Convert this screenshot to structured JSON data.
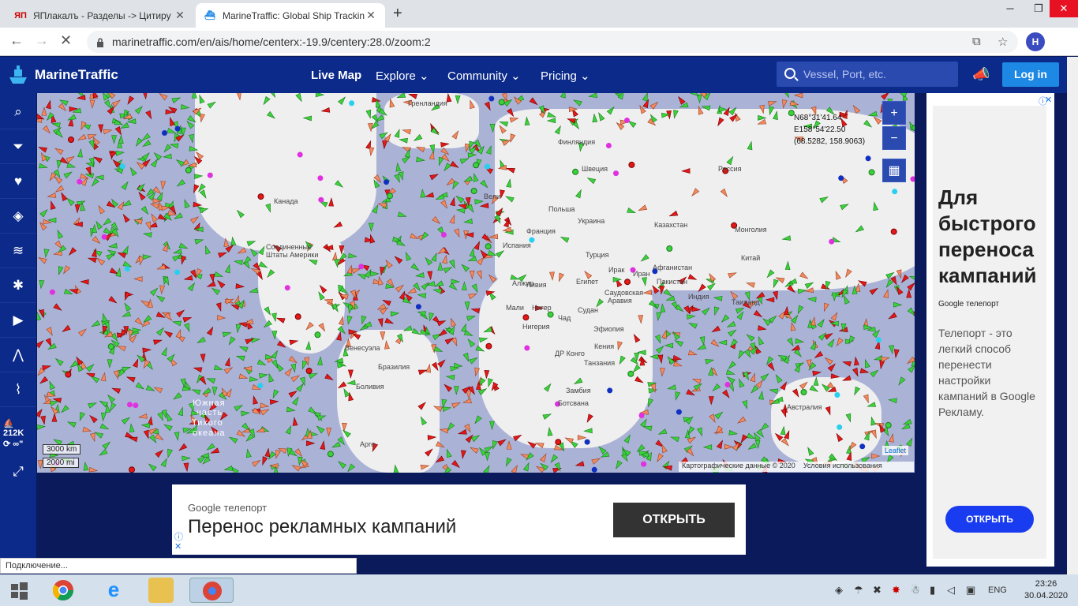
{
  "browser": {
    "tabs": [
      {
        "favicon": "yaplakal-favicon",
        "title": "ЯПлакалъ - Разделы -> Цитиру"
      },
      {
        "favicon": "marinetraffic-favicon",
        "title": "MarineTraffic: Global Ship Trackin"
      }
    ],
    "url": "marinetraffic.com/en/ais/home/centerx:-19.9/centery:28.0/zoom:2",
    "profile_initial": "H"
  },
  "header": {
    "brand": "MarineTraffic",
    "nav": [
      "Live Map",
      "Explore",
      "Community",
      "Pricing"
    ],
    "search_placeholder": "Vessel, Port, etc.",
    "login": "Log in"
  },
  "sidebar": {
    "icons": [
      "search-icon",
      "filter-icon",
      "heart-icon",
      "layers-icon",
      "wind-icon",
      "routes-icon",
      "play-icon",
      "measure-icon",
      "analytics-icon"
    ],
    "vessel_count": "212K",
    "loop_label": "∞\""
  },
  "map": {
    "coordinate": [
      "N68°31'41.64",
      "E158°54'22.50",
      "(68.5282, 158.9063)"
    ],
    "scale": [
      "3000 km",
      "2000 mi"
    ],
    "attribution": [
      "Картографические данные © 2020",
      "Условия использования"
    ],
    "leaflet": "Leaflet",
    "labels": [
      {
        "t": "Гренландия"
      },
      {
        "t": "Канада"
      },
      {
        "t": "Соединенные"
      },
      {
        "t": "Штаты Америки"
      },
      {
        "t": "Финляндия"
      },
      {
        "t": "Швеция"
      },
      {
        "t": "Россия"
      },
      {
        "t": "Вели"
      },
      {
        "t": "Польша"
      },
      {
        "t": "Украина"
      },
      {
        "t": "Франция"
      },
      {
        "t": "Испания"
      },
      {
        "t": "Турция"
      },
      {
        "t": "Казахстан"
      },
      {
        "t": "Монголия"
      },
      {
        "t": "Китай"
      },
      {
        "t": "Алжир"
      },
      {
        "t": "Ливия"
      },
      {
        "t": "Египет"
      },
      {
        "t": "Ирак"
      },
      {
        "t": "Иран"
      },
      {
        "t": "Афганистан"
      },
      {
        "t": "Пакистан"
      },
      {
        "t": "Индия"
      },
      {
        "t": "Саудовская"
      },
      {
        "t": "Аравия"
      },
      {
        "t": "Мали"
      },
      {
        "t": "Нигер"
      },
      {
        "t": "Чад"
      },
      {
        "t": "Судан"
      },
      {
        "t": "Нигерия"
      },
      {
        "t": "Эфиопия"
      },
      {
        "t": "Кения"
      },
      {
        "t": "ДР Конго"
      },
      {
        "t": "Танзания"
      },
      {
        "t": "Замбия"
      },
      {
        "t": "Ботсвана"
      },
      {
        "t": "Таиланд"
      },
      {
        "t": "Бразилия"
      },
      {
        "t": "Боливия"
      },
      {
        "t": "Венесуэла"
      },
      {
        "t": "Австралия"
      },
      {
        "t": "Южная"
      },
      {
        "t": "часть"
      },
      {
        "t": "Тихого"
      },
      {
        "t": "океана"
      },
      {
        "t": "Арге"
      }
    ]
  },
  "ads": {
    "right": {
      "headline": "Для быстрого переноса кампаний",
      "sponsor": "Google телепорт",
      "body": "Телепорт - это легкий способ перенести настройки кампаний в Google Рекламу.",
      "button": "ОТКРЫТЬ"
    },
    "bottom": {
      "sponsor": "Google телепорт",
      "headline": "Перенос рекламных кампаний",
      "button": "ОТКРЫТЬ"
    }
  },
  "status_text": "Подключение...",
  "taskbar": {
    "apps": [
      "start-icon",
      "chrome-icon",
      "ie-icon",
      "explorer-icon",
      "chrome-profile-icon"
    ],
    "lang": "ENG",
    "time": "23:26",
    "date": "30.04.2020"
  }
}
